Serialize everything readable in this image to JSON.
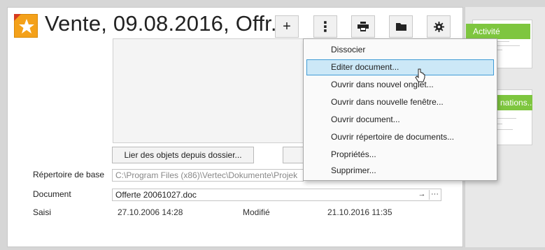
{
  "window": {
    "title": "Vente, 09.08.2016, Offr...",
    "icon": "star-document-icon"
  },
  "toolbar": {
    "buttons": [
      {
        "name": "add-button",
        "label": "+",
        "icon": "plus-icon"
      },
      {
        "name": "more-button",
        "label": "⋮",
        "icon": "vertical-dots-icon"
      },
      {
        "name": "print-button",
        "icon": "printer-icon"
      },
      {
        "name": "folder-button",
        "icon": "folder-icon"
      },
      {
        "name": "settings-button",
        "icon": "gear-icon"
      }
    ]
  },
  "actions": {
    "link_objects_label": "Lier des objets depuis dossier..."
  },
  "form": {
    "base_dir_label": "Répertoire de base",
    "base_dir_value": "C:\\Program Files (x86)\\Vertec\\Dokumente\\Projek",
    "document_label": "Document",
    "document_value": "Offerte 20061027.doc",
    "saisi_label": "Saisi",
    "saisi_value": "27.10.2006 14:28",
    "modifie_label": "Modifié",
    "modifie_value": "21.10.2016 11:35"
  },
  "side_panel": {
    "tab1": "Activité",
    "tab2": "nations..."
  },
  "context_menu": {
    "items": [
      {
        "label": "Dissocier"
      },
      {
        "label": "Editer document...",
        "highlighted": true
      },
      {
        "label": "Ouvrir dans nouvel onglet..."
      },
      {
        "label": "Ouvrir dans nouvelle fenêtre..."
      },
      {
        "label": "Ouvrir document..."
      },
      {
        "label": "Ouvrir répertoire de documents..."
      },
      {
        "label": "Propriétés..."
      },
      {
        "label": "Supprimer..."
      }
    ]
  },
  "colors": {
    "accent_green": "#7ec63f",
    "menu_highlight": "#cce8f7",
    "menu_highlight_border": "#3f9bd6",
    "icon_orange": "#f4a11a"
  }
}
